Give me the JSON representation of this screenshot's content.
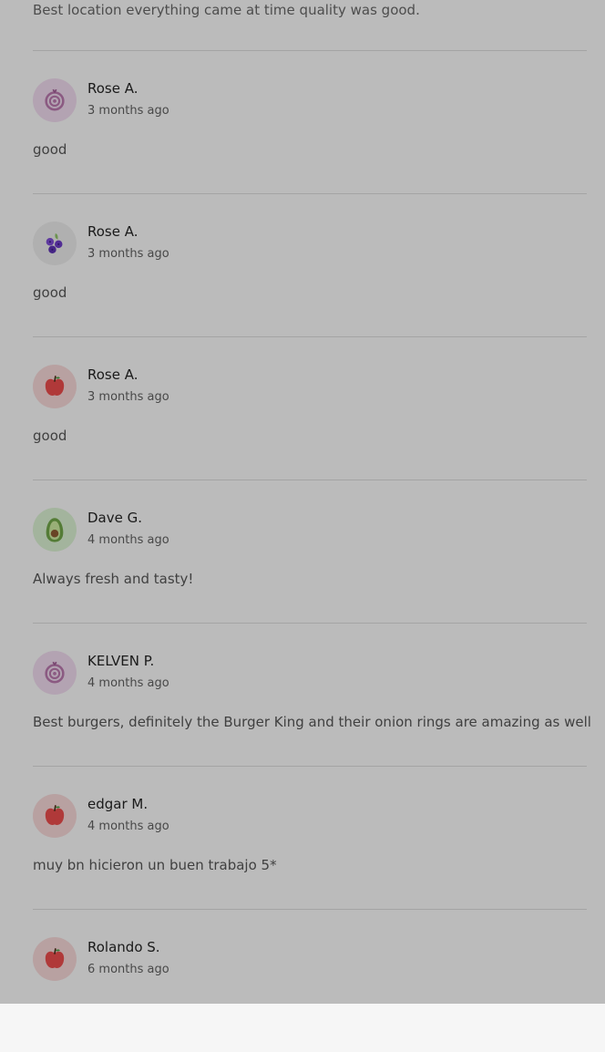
{
  "top_review_text": "Best location everything came at time quality was good.",
  "reviews": [
    {
      "name": "Rose A.",
      "date": "3 months ago",
      "text": "good",
      "avatar_icon": "onion-icon",
      "avatar_color": "#ecd7ea"
    },
    {
      "name": "Rose A.",
      "date": "3 months ago",
      "text": "good",
      "avatar_icon": "blueberry-icon",
      "avatar_color": "#e8e8e8"
    },
    {
      "name": "Rose A.",
      "date": "3 months ago",
      "text": "good",
      "avatar_icon": "apple-icon",
      "avatar_color": "#f2d4d4"
    },
    {
      "name": "Dave G.",
      "date": "4 months ago",
      "text": "Always fresh and tasty!",
      "avatar_icon": "avocado-icon",
      "avatar_color": "#d6edcf"
    },
    {
      "name": "KELVEN P.",
      "date": "4 months ago",
      "text": "Best burgers, definitely the Burger King and their onion rings are amazing as well",
      "avatar_icon": "onion-icon",
      "avatar_color": "#ecd7ea"
    },
    {
      "name": "edgar M.",
      "date": "4 months ago",
      "text": "muy bn hicieron un buen trabajo 5*",
      "avatar_icon": "apple-icon",
      "avatar_color": "#f2d4d4"
    },
    {
      "name": "Rolando S.",
      "date": "6 months ago",
      "text": "",
      "avatar_icon": "apple-icon",
      "avatar_color": "#f2d4d4"
    }
  ]
}
